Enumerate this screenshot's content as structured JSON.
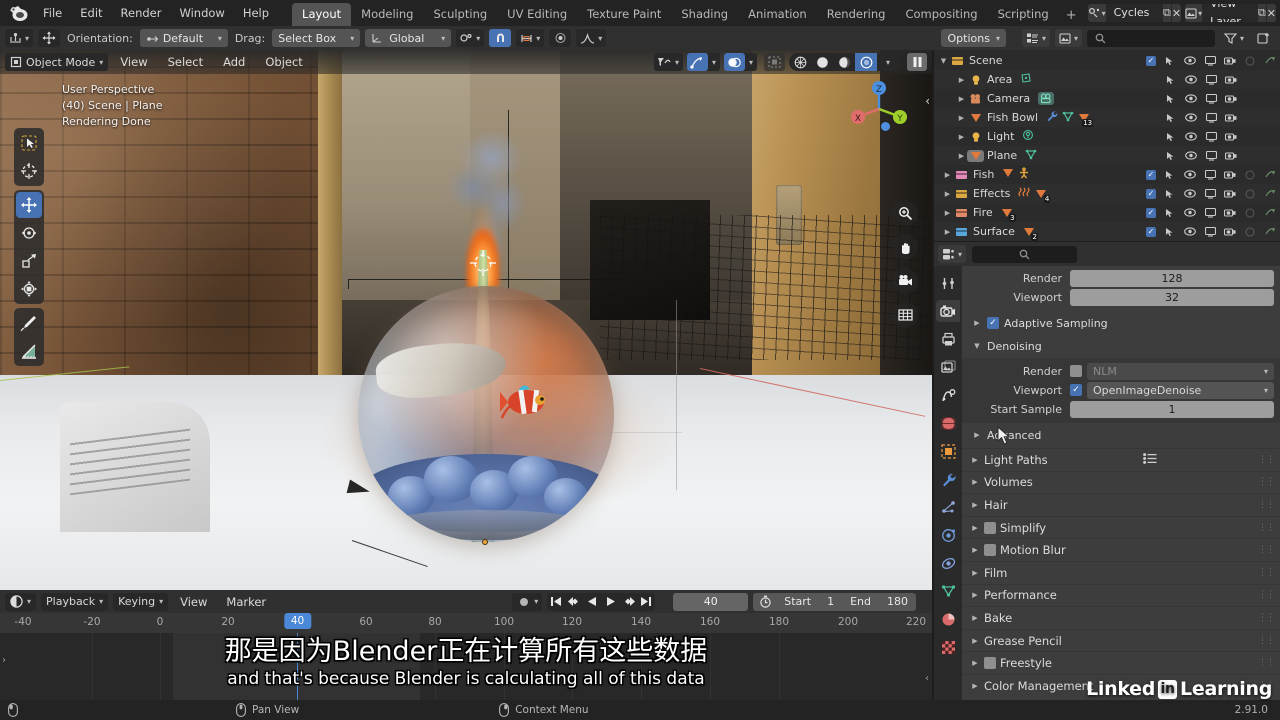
{
  "topbar": {
    "logo": "blender-logo",
    "menus": [
      "File",
      "Edit",
      "Render",
      "Window",
      "Help"
    ],
    "workspaces": [
      {
        "label": "Layout",
        "active": true
      },
      {
        "label": "Modeling",
        "active": false
      },
      {
        "label": "Sculpting",
        "active": false
      },
      {
        "label": "UV Editing",
        "active": false
      },
      {
        "label": "Texture Paint",
        "active": false
      },
      {
        "label": "Shading",
        "active": false
      },
      {
        "label": "Animation",
        "active": false
      },
      {
        "label": "Rendering",
        "active": false
      },
      {
        "label": "Compositing",
        "active": false
      },
      {
        "label": "Scripting",
        "active": false
      }
    ],
    "add_workspace": "+",
    "scene_name": "Cycles",
    "view_layer_name": "View Layer",
    "copy_glyph": "⧉",
    "close_glyph": "✕"
  },
  "toolsettings": {
    "orientation_label": "Orientation:",
    "orientation_value": "Default",
    "drag_label": "Drag:",
    "drag_value": "Select Box",
    "transform_value": "Global",
    "options_label": "Options"
  },
  "viewport": {
    "mode": "Object Mode",
    "menus": [
      "View",
      "Select",
      "Add",
      "Object"
    ],
    "info_lines": [
      "User Perspective",
      "(40) Scene | Plane",
      "Rendering Done"
    ],
    "tools": [
      {
        "name": "tweak-tool",
        "glyph": "➤",
        "active": false
      },
      {
        "name": "cursor-tool",
        "glyph": "⊕",
        "active": false
      },
      {
        "name": "move-tool",
        "glyph": "✥",
        "active": true
      },
      {
        "name": "rotate-tool",
        "glyph": "⟳",
        "active": false
      },
      {
        "name": "scale-tool",
        "glyph": "⧉",
        "active": false
      },
      {
        "name": "transform-tool",
        "glyph": "⬚",
        "active": false
      },
      {
        "name": "annotate-tool",
        "glyph": "✎",
        "active": false
      },
      {
        "name": "measure-tool",
        "glyph": "⮡",
        "active": false
      }
    ],
    "gizmo_axes": [
      {
        "label": "Z",
        "color": "#4b8fe0"
      },
      {
        "label": "X",
        "color": "#e06c6c"
      },
      {
        "label": "Y",
        "color": "#9ece2a"
      }
    ],
    "nav_icons": [
      "zoom-icon",
      "hand-icon",
      "camera-icon",
      "grid-icon"
    ],
    "shading_modes": [
      "wireframe",
      "solid",
      "material-preview",
      "rendered"
    ],
    "shading_active": "rendered"
  },
  "outliner": {
    "search_placeholder": "",
    "rows": [
      {
        "name": "Scene",
        "indent": 0,
        "icon": "scene-collection-icon",
        "icon_color": "#d9a843",
        "expanded": true,
        "checkbox": true,
        "extras": [],
        "disclosure": "down"
      },
      {
        "name": "Area",
        "indent": 1,
        "icon": "light-icon",
        "icon_color": "#e9b44a",
        "expanded": false,
        "checkbox": false,
        "extras": [
          {
            "name": "light-data-icon",
            "color": "#4fc0a0"
          }
        ],
        "disclosure": "right"
      },
      {
        "name": "Camera",
        "indent": 1,
        "icon": "camera-icon",
        "icon_color": "#d98a5a",
        "expanded": false,
        "checkbox": false,
        "extras": [
          {
            "name": "camera-data-icon",
            "color": "#4fc0a0",
            "highlight": true
          }
        ],
        "disclosure": "right"
      },
      {
        "name": "Fish Bowl",
        "indent": 1,
        "icon": "mesh-icon",
        "icon_color": "#e07a3c",
        "expanded": false,
        "checkbox": false,
        "extras": [
          {
            "name": "modifier-wrench-icon",
            "color": "#5b8fd9"
          },
          {
            "name": "mesh-data-icon",
            "color": "#4fc0a0"
          },
          {
            "name": "material-icon",
            "color": "#e07a3c",
            "badge": "13"
          }
        ],
        "disclosure": "right"
      },
      {
        "name": "Light",
        "indent": 1,
        "icon": "light-icon",
        "icon_color": "#e9b44a",
        "expanded": false,
        "checkbox": false,
        "extras": [
          {
            "name": "light-data-icon",
            "color": "#4fc0a0"
          }
        ],
        "disclosure": "right"
      },
      {
        "name": "Plane",
        "indent": 1,
        "icon": "mesh-icon",
        "icon_color": "#e07a3c",
        "expanded": false,
        "checkbox": false,
        "selected": true,
        "extras": [
          {
            "name": "mesh-data-icon",
            "color": "#4fc0a0"
          }
        ],
        "disclosure": "right"
      },
      {
        "name": "Fish",
        "indent": 0,
        "icon": "collection-icon",
        "icon_color": "#e28bb8",
        "expanded": false,
        "checkbox": true,
        "extras": [
          {
            "name": "mesh-icon",
            "color": "#e07a3c"
          },
          {
            "name": "armature-icon",
            "color": "#e0a03c"
          }
        ],
        "disclosure": "right"
      },
      {
        "name": "Effects",
        "indent": 0,
        "icon": "collection-icon",
        "icon_color": "#d9a843",
        "expanded": false,
        "checkbox": true,
        "extras": [
          {
            "name": "force-field-icon",
            "color": "#e07a3c"
          },
          {
            "name": "mesh-icon",
            "color": "#e07a3c",
            "badge": "4"
          }
        ],
        "disclosure": "right"
      },
      {
        "name": "Fire",
        "indent": 0,
        "icon": "collection-icon",
        "icon_color": "#e08a6a",
        "expanded": false,
        "checkbox": true,
        "extras": [
          {
            "name": "mesh-icon",
            "color": "#e07a3c",
            "badge": "3"
          }
        ],
        "disclosure": "right"
      },
      {
        "name": "Surface",
        "indent": 0,
        "icon": "collection-icon",
        "icon_color": "#5aa8d9",
        "expanded": false,
        "checkbox": true,
        "extras": [
          {
            "name": "mesh-icon",
            "color": "#e07a3c",
            "badge": "2"
          }
        ],
        "disclosure": "right"
      }
    ],
    "column_icons": [
      "select-arrow-icon",
      "eye-icon",
      "screen-icon",
      "camera-icon",
      "holdout-icon",
      "indirect-only-icon"
    ]
  },
  "properties": {
    "editor_type": "render-properties-icon",
    "search_placeholder": "",
    "tabs": [
      {
        "name": "tool-tab",
        "glyph": "⚒",
        "active": false,
        "color": "#cfcfcf"
      },
      {
        "name": "render-tab",
        "glyph": "☀",
        "active": true,
        "color": "#dcdcdc"
      },
      {
        "name": "output-tab",
        "glyph": "⎙",
        "active": false,
        "color": "#cfcfcf"
      },
      {
        "name": "view-layer-tab",
        "glyph": "❑",
        "active": false,
        "color": "#cfcfcf"
      },
      {
        "name": "scene-tab",
        "glyph": "◔",
        "active": false,
        "color": "#dcdcdc"
      },
      {
        "name": "world-tab",
        "glyph": "⬤",
        "active": false,
        "color": "#d96a6a"
      },
      {
        "name": "object-tab",
        "glyph": "▣",
        "active": false,
        "color": "#e89a3c"
      },
      {
        "name": "modifier-tab",
        "glyph": "ὒ7",
        "active": false,
        "color": "#5b8fd9"
      },
      {
        "name": "particles-tab",
        "glyph": "⚛",
        "active": false,
        "color": "#8fa8d9"
      },
      {
        "name": "physics-tab",
        "glyph": "◎",
        "active": false,
        "color": "#6f9ad9"
      },
      {
        "name": "constraints-tab",
        "glyph": "❂",
        "active": false,
        "color": "#7fa0d9"
      },
      {
        "name": "data-tab",
        "glyph": "▽",
        "active": false,
        "color": "#4fc0a0"
      },
      {
        "name": "material-tab",
        "glyph": "◕",
        "active": false,
        "color": "#d96a6a"
      },
      {
        "name": "texture-tab",
        "glyph": "▓",
        "active": false,
        "color": "#d96a6a"
      }
    ],
    "sampling": {
      "render_label": "Render",
      "render_value": "128",
      "viewport_label": "Viewport",
      "viewport_value": "32",
      "adaptive_sampling_label": "Adaptive Sampling",
      "adaptive_sampling_checked": true
    },
    "denoising": {
      "title": "Denoising",
      "expanded": true,
      "render_label": "Render",
      "render_checked": false,
      "render_value": "NLM",
      "viewport_label": "Viewport",
      "viewport_checked": true,
      "viewport_value": "OpenImageDenoise",
      "start_sample_label": "Start Sample",
      "start_sample_value": "1",
      "advanced_label": "Advanced"
    },
    "panels": [
      {
        "label": "Light Paths",
        "checkbox": null,
        "has_list_icon": true
      },
      {
        "label": "Volumes",
        "checkbox": null
      },
      {
        "label": "Hair",
        "checkbox": null
      },
      {
        "label": "Simplify",
        "checkbox": false
      },
      {
        "label": "Motion Blur",
        "checkbox": false
      },
      {
        "label": "Film",
        "checkbox": null
      },
      {
        "label": "Performance",
        "checkbox": null
      },
      {
        "label": "Bake",
        "checkbox": null
      },
      {
        "label": "Grease Pencil",
        "checkbox": null
      },
      {
        "label": "Freestyle",
        "checkbox": false
      },
      {
        "label": "Color Management",
        "checkbox": null
      }
    ]
  },
  "timeline": {
    "editor_icon": "timeline-editor-icon",
    "menus": [
      "Playback",
      "Keying",
      "View",
      "Marker"
    ],
    "record_icon": "record-icon",
    "playback_buttons": [
      "jump-start-icon",
      "prev-keyframe-icon",
      "play-reverse-icon",
      "play-icon",
      "next-keyframe-icon",
      "jump-end-icon"
    ],
    "current_frame": "40",
    "auto_key_icon": "stopwatch-icon",
    "start_label": "Start",
    "start_value": "1",
    "end_label": "End",
    "end_value": "180",
    "ruler_ticks": [
      "-40",
      "-20",
      "0",
      "20",
      "40",
      "60",
      "80",
      "100",
      "120",
      "140",
      "160",
      "180",
      "200",
      "220"
    ],
    "playhead_label": "40"
  },
  "subtitles": {
    "line_cn": "那是因为Blender正在计算所有这些数据",
    "line_en": "and that's because Blender is calculating all of this data"
  },
  "watermark": {
    "text1": "Linked",
    "badge": "in",
    "text2": "Learning"
  },
  "statusbar": {
    "left_icon": "mouse-middle-icon",
    "items": [
      {
        "icon": "mouse-middle-icon",
        "label": "Pan View"
      },
      {
        "icon": "mouse-right-icon",
        "label": "Context Menu"
      }
    ],
    "version": "2.91.0"
  },
  "colors": {
    "accent_blue": "#4772b3",
    "playhead_blue": "#4b88d8",
    "panel_bg": "#303030",
    "editor_bg": "#3d3d3d",
    "outliner_bg": "#2b2b2b"
  }
}
